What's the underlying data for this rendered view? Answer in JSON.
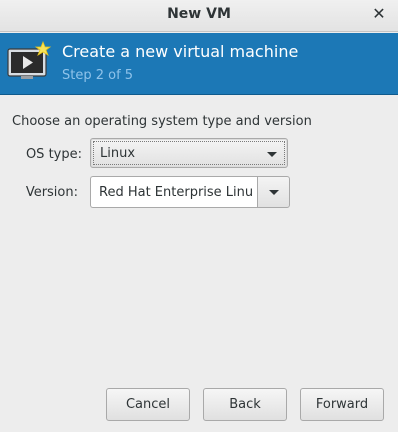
{
  "window": {
    "title": "New VM",
    "close_icon": "close-icon"
  },
  "banner": {
    "heading": "Create a new virtual machine",
    "subheading": "Step 2 of 5",
    "background_color": "#1c78b6",
    "icon": "virtual-machine-new-icon"
  },
  "form": {
    "prompt": "Choose an operating system type and version",
    "os_type": {
      "label": "OS type:",
      "value": "Linux"
    },
    "version": {
      "label": "Version:",
      "value": "Red Hat Enterprise Linu"
    }
  },
  "buttons": {
    "cancel": "Cancel",
    "back": "Back",
    "forward": "Forward"
  }
}
